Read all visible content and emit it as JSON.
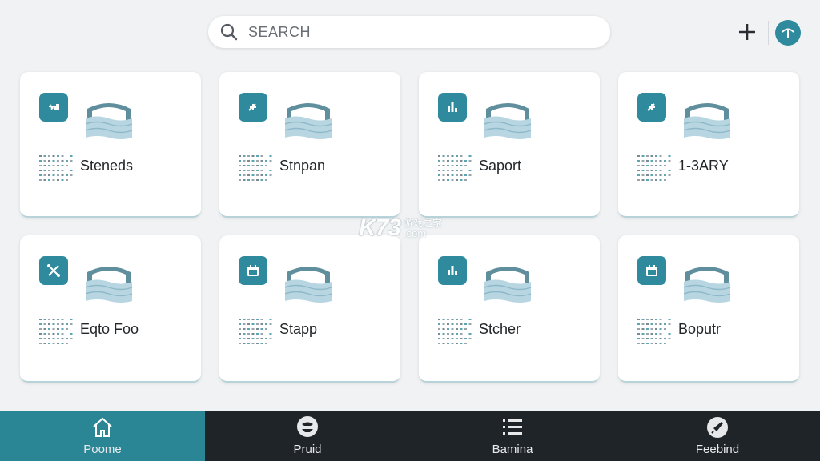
{
  "search": {
    "placeholder": "SEARCH"
  },
  "header": {
    "add_icon": "plus-icon",
    "avatar_icon": "upload-icon",
    "accent": "#2e8a9c"
  },
  "cards": [
    {
      "label": "Steneds",
      "icon": "key-icon"
    },
    {
      "label": "Stnpan",
      "icon": "sparkle-icon"
    },
    {
      "label": "Saport",
      "icon": "bar-chart-icon"
    },
    {
      "label": "1-3ARY",
      "icon": "sparkle-icon"
    },
    {
      "label": "Eqto Foo",
      "icon": "tools-icon"
    },
    {
      "label": "Stapp",
      "icon": "calendar-icon"
    },
    {
      "label": "Stcher",
      "icon": "bar-chart-icon"
    },
    {
      "label": "Boputr",
      "icon": "calendar-icon"
    }
  ],
  "watermark": {
    "main": "K73",
    "cn": "游戏之家",
    "domain": ".com"
  },
  "nav": [
    {
      "label": "Poome",
      "icon": "home-icon",
      "active": true
    },
    {
      "label": "Pruid",
      "icon": "chat-icon",
      "active": false
    },
    {
      "label": "Bamina",
      "icon": "list-icon",
      "active": false
    },
    {
      "label": "Feebind",
      "icon": "rocket-icon",
      "active": false
    }
  ],
  "colors": {
    "accent": "#2e8a9c",
    "nav_bg": "#1f2428",
    "nav_active": "#2a8595",
    "page_bg": "#f1f2f4"
  }
}
